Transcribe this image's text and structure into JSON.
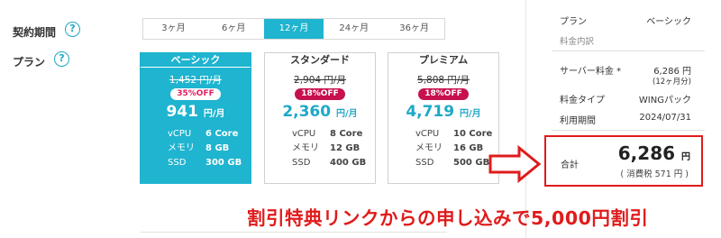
{
  "labels": {
    "period": "契約期間",
    "plan": "プラン"
  },
  "period_tabs": [
    {
      "label": "3ヶ月",
      "active": false
    },
    {
      "label": "6ヶ月",
      "active": false
    },
    {
      "label": "12ヶ月",
      "active": true
    },
    {
      "label": "24ヶ月",
      "active": false
    },
    {
      "label": "36ヶ月",
      "active": false
    }
  ],
  "plans": [
    {
      "name": "ベーシック",
      "old_price": "1,452 円/月",
      "discount": "35%OFF",
      "price": "941",
      "price_unit": "円/月",
      "specs": [
        {
          "k": "vCPU",
          "v": "6 Core"
        },
        {
          "k": "メモリ",
          "v": "8 GB"
        },
        {
          "k": "SSD",
          "v": "300 GB"
        }
      ],
      "selected": true
    },
    {
      "name": "スタンダード",
      "old_price": "2,904 円/月",
      "discount": "18%OFF",
      "price": "2,360",
      "price_unit": "円/月",
      "specs": [
        {
          "k": "vCPU",
          "v": "8 Core"
        },
        {
          "k": "メモリ",
          "v": "12 GB"
        },
        {
          "k": "SSD",
          "v": "400 GB"
        }
      ],
      "selected": false
    },
    {
      "name": "プレミアム",
      "old_price": "5,808 円/月",
      "discount": "18%OFF",
      "price": "4,719",
      "price_unit": "円/月",
      "specs": [
        {
          "k": "vCPU",
          "v": "10 Core"
        },
        {
          "k": "メモリ",
          "v": "16 GB"
        },
        {
          "k": "SSD",
          "v": "500 GB"
        }
      ],
      "selected": false
    }
  ],
  "summary": {
    "plan_key": "プラン",
    "plan_value": "ベーシック",
    "breakdown_heading": "料金内訳",
    "server_fee_key": "サーバー料金 *",
    "server_fee_value": "6,286 円",
    "server_fee_note": "(12ヶ月分)",
    "fee_type_key": "料金タイプ",
    "fee_type_value": "WINGパック",
    "period_key": "利用期間",
    "period_value": "2024/07/31",
    "total_key": "合計",
    "total_value": "6,286",
    "total_unit": "円",
    "tax_note": "( 消費税 571 円 )"
  },
  "promo_text": "割引特典リンクからの申し込みで5,000円割引",
  "colors": {
    "accent": "#1fb4cf",
    "discount": "#c7104f",
    "promo": "#e01b1b"
  }
}
